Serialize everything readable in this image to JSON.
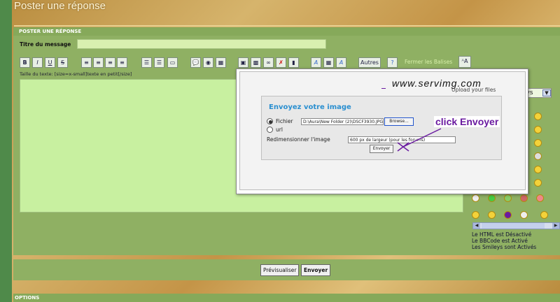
{
  "page": {
    "title": "Poster une réponse",
    "form_header": "POSTER UNE RÉPONSE",
    "subject_label": "Titre du message",
    "subject_value": "",
    "size_hint": "Taille du texte: [size=x-small]texte en petit[/size]",
    "message_value": ""
  },
  "toolbar": {
    "buttons": [
      "B",
      "I",
      "U",
      "S"
    ],
    "autres_label": "Autres",
    "fermer_label": "Fermer les Balises"
  },
  "side": {
    "select_value": "eys",
    "status_html": "Le HTML est Désactivé",
    "status_bbcode": "Le BBCode est Activé",
    "status_smileys": "Les Smileys sont Activés"
  },
  "actions": {
    "preview_label": "Prévisualiser",
    "send_label": "Envoyer"
  },
  "options": {
    "label": "OPTIONS"
  },
  "popup": {
    "brand": "www.servimg.com",
    "tagline": "Upload your files",
    "heading": "Envoyez votre image",
    "file_label": "Fichier",
    "file_value": "D:\\Aura\\New Folder (2)\\DSCF3930.JPG",
    "browse_label": "Browse...",
    "url_label": "url",
    "resize_label": "Redimensionner l'image",
    "resize_value": "600 px de largeur (pour les forums)",
    "submit_label": "Envoyer"
  },
  "annotation": {
    "text": "click Envoyer",
    "color": "#6a1aa0"
  },
  "colors": {
    "form_bg": "#8fb063",
    "textarea_bg": "#c8f0a0",
    "accent_blue": "#2a8fd0"
  }
}
